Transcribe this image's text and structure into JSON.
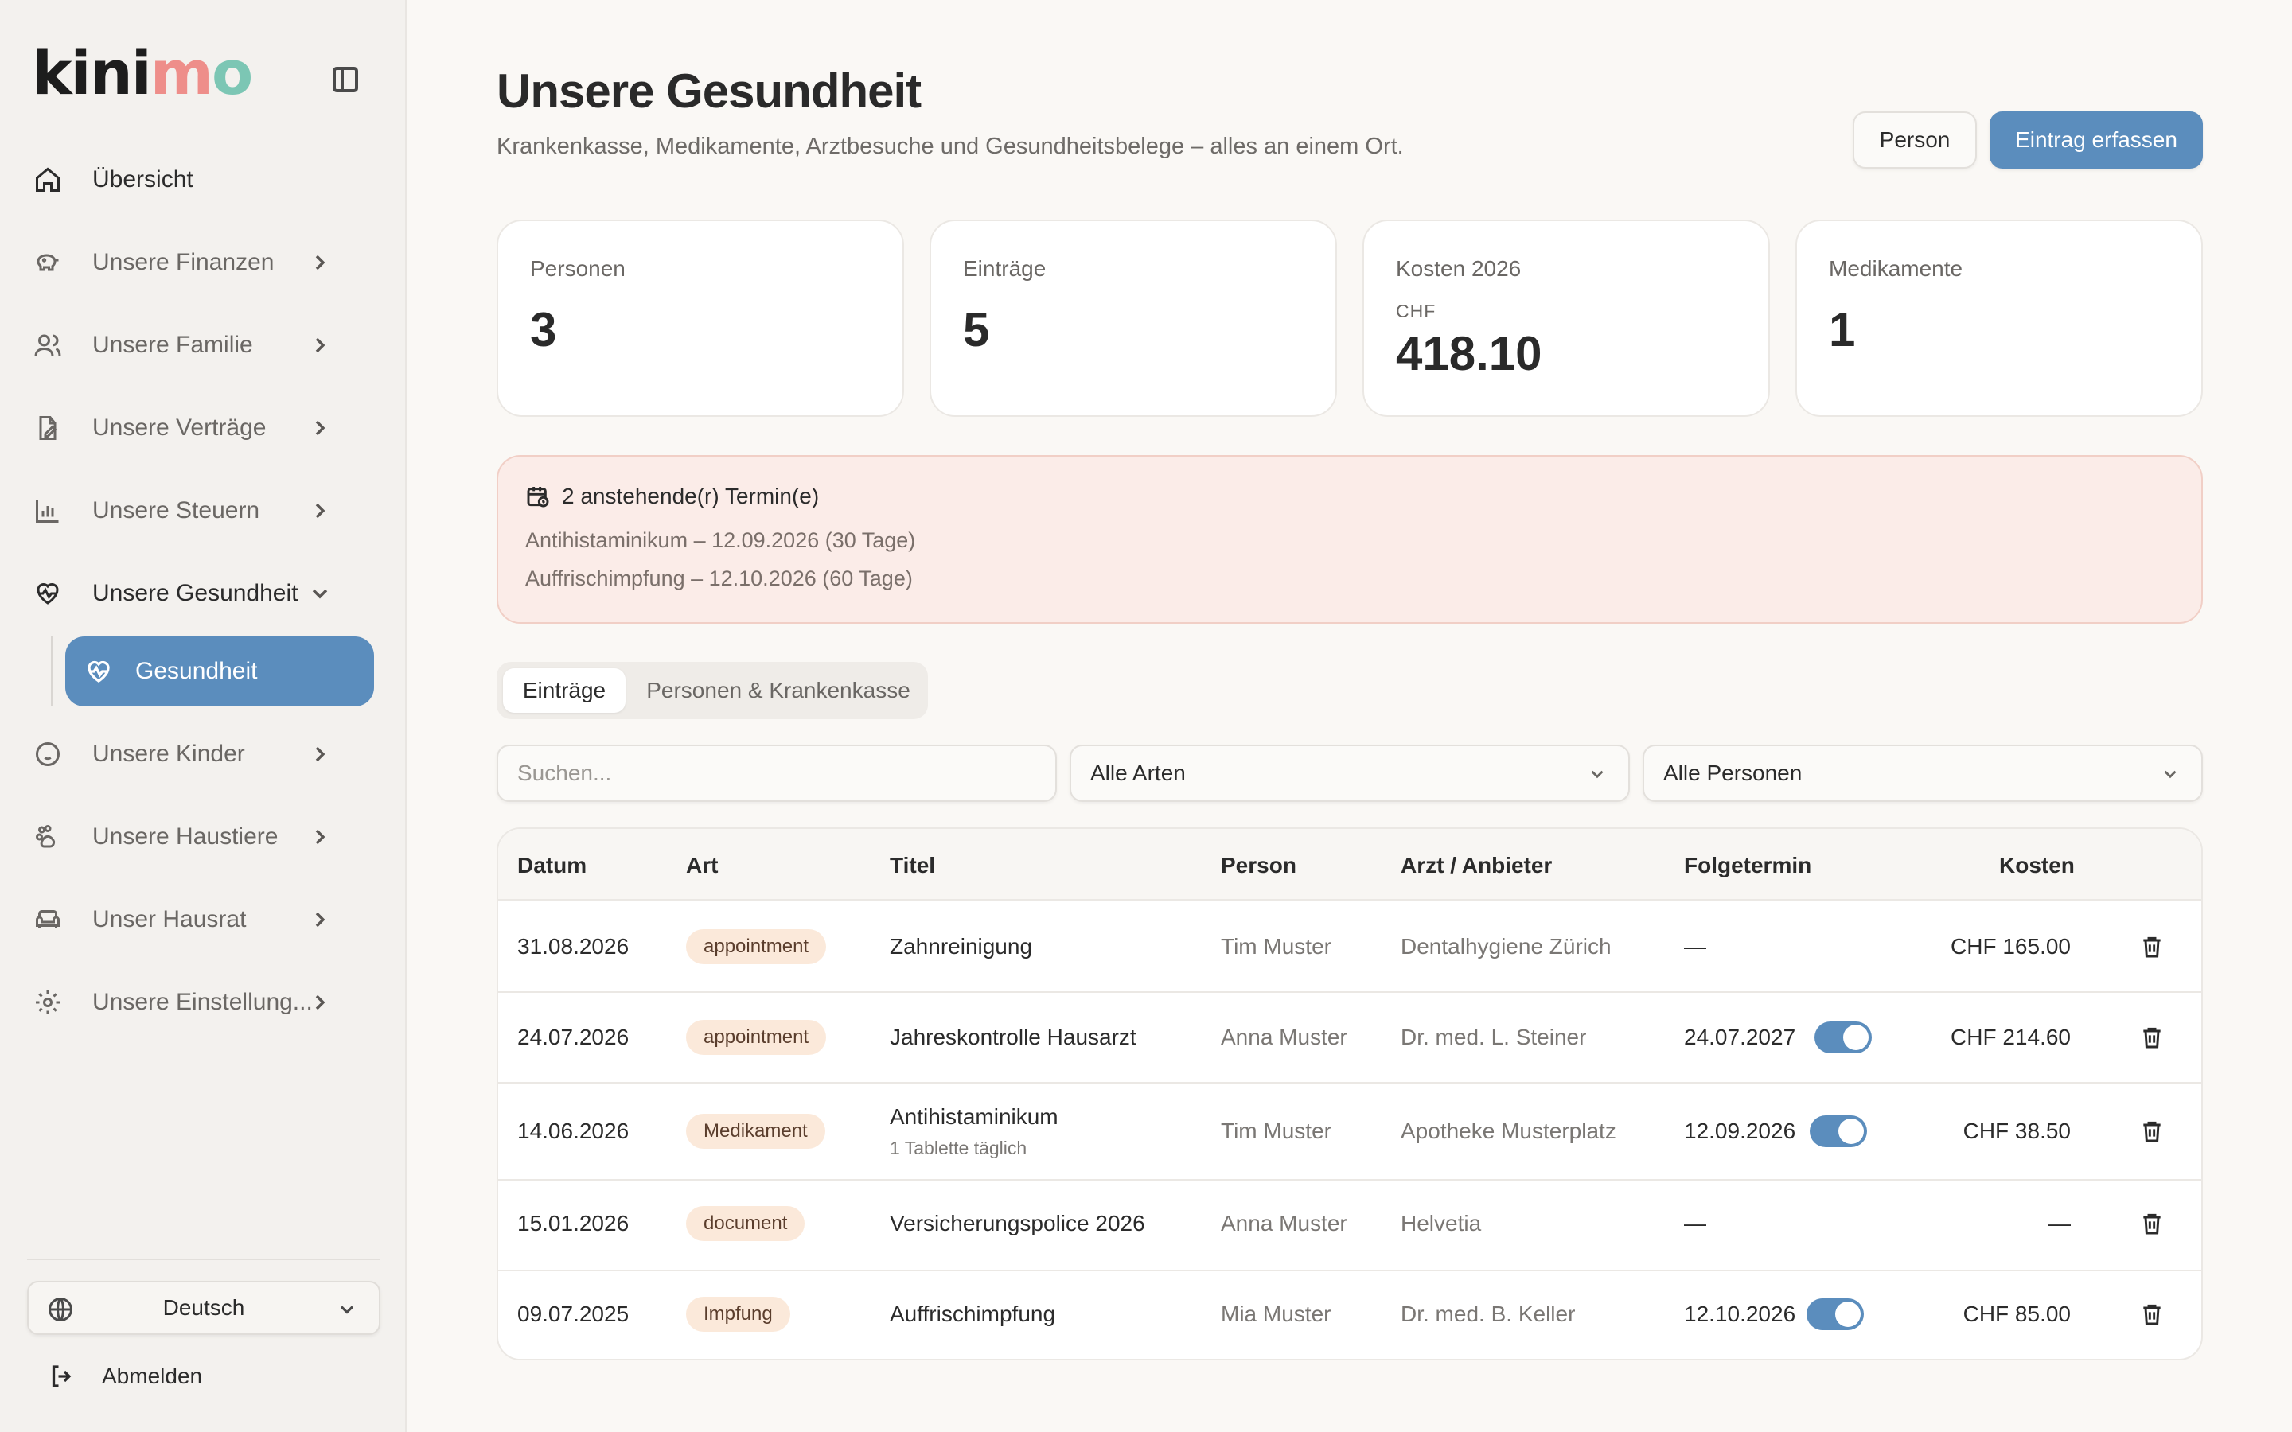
{
  "app": {
    "logo_text": "kinimo"
  },
  "sidebar": {
    "items": [
      {
        "label": "Übersicht",
        "icon": "home-icon"
      },
      {
        "label": "Unsere Finanzen",
        "icon": "piggy-bank-icon"
      },
      {
        "label": "Unsere Familie",
        "icon": "users-icon"
      },
      {
        "label": "Unsere Verträge",
        "icon": "file-edit-icon"
      },
      {
        "label": "Unsere Steuern",
        "icon": "bar-chart-icon"
      },
      {
        "label": "Unsere Gesundheit",
        "icon": "heart-pulse-icon"
      },
      {
        "label": "Unsere Kinder",
        "icon": "baby-icon"
      },
      {
        "label": "Unsere Haustiere",
        "icon": "paw-icon"
      },
      {
        "label": "Unser Hausrat",
        "icon": "sofa-icon"
      },
      {
        "label": "Unsere Einstellung...",
        "icon": "gear-icon"
      }
    ],
    "active_sub": {
      "label": "Gesundheit",
      "icon": "heart-pulse-icon"
    },
    "language": "Deutsch",
    "logout": "Abmelden"
  },
  "header": {
    "title": "Unsere Gesundheit",
    "subtitle": "Krankenkasse, Medikamente, Arztbesuche und Gesundheitsbelege – alles an einem Ort.",
    "btn_person": "Person",
    "btn_add": "Eintrag erfassen"
  },
  "stats": {
    "persons": {
      "label": "Personen",
      "value": "3"
    },
    "entries": {
      "label": "Einträge",
      "value": "5"
    },
    "costs": {
      "label": "Kosten 2026",
      "currency": "CHF",
      "value": "418.10"
    },
    "meds": {
      "label": "Medikamente",
      "value": "1"
    }
  },
  "alert": {
    "title": "2 anstehende(r) Termin(e)",
    "lines": [
      "Antihistaminikum – 12.09.2026 (30 Tage)",
      "Auffrischimpfung – 12.10.2026 (60 Tage)"
    ]
  },
  "tabs": {
    "entries": "Einträge",
    "persons": "Personen & Krankenkasse"
  },
  "filters": {
    "search_placeholder": "Suchen...",
    "type": "Alle Arten",
    "person": "Alle Personen"
  },
  "table": {
    "headers": {
      "date": "Datum",
      "type": "Art",
      "title": "Titel",
      "person": "Person",
      "provider": "Arzt / Anbieter",
      "followup": "Folgetermin",
      "cost": "Kosten"
    },
    "rows": [
      {
        "date": "31.08.2026",
        "type": "appointment",
        "title": "Zahnreinigung",
        "note": "",
        "person": "Tim Muster",
        "provider": "Dentalhygiene Zürich",
        "followup": "—",
        "reminder": false,
        "cost": "CHF 165.00"
      },
      {
        "date": "24.07.2026",
        "type": "appointment",
        "title": "Jahreskontrolle Hausarzt",
        "note": "",
        "person": "Anna Muster",
        "provider": "Dr. med. L. Steiner",
        "followup": "24.07.2027",
        "reminder": true,
        "cost": "CHF 214.60"
      },
      {
        "date": "14.06.2026",
        "type": "Medikament",
        "title": "Antihistaminikum",
        "note": "1 Tablette täglich",
        "person": "Tim Muster",
        "provider": "Apotheke Musterplatz",
        "followup": "12.09.2026",
        "reminder": true,
        "cost": "CHF 38.50"
      },
      {
        "date": "15.01.2026",
        "type": "document",
        "title": "Versicherungspolice 2026",
        "note": "",
        "person": "Anna Muster",
        "provider": "Helvetia",
        "followup": "—",
        "reminder": false,
        "cost": "—"
      },
      {
        "date": "09.07.2025",
        "type": "Impfung",
        "title": "Auffrischimpfung",
        "note": "",
        "person": "Mia Muster",
        "provider": "Dr. med. B. Keller",
        "followup": "12.10.2026",
        "reminder": true,
        "cost": "CHF 85.00"
      }
    ]
  },
  "colors": {
    "accent": "#5b8dbd",
    "alert_bg": "#fbece8",
    "badge_bg": "#fbe9da"
  }
}
